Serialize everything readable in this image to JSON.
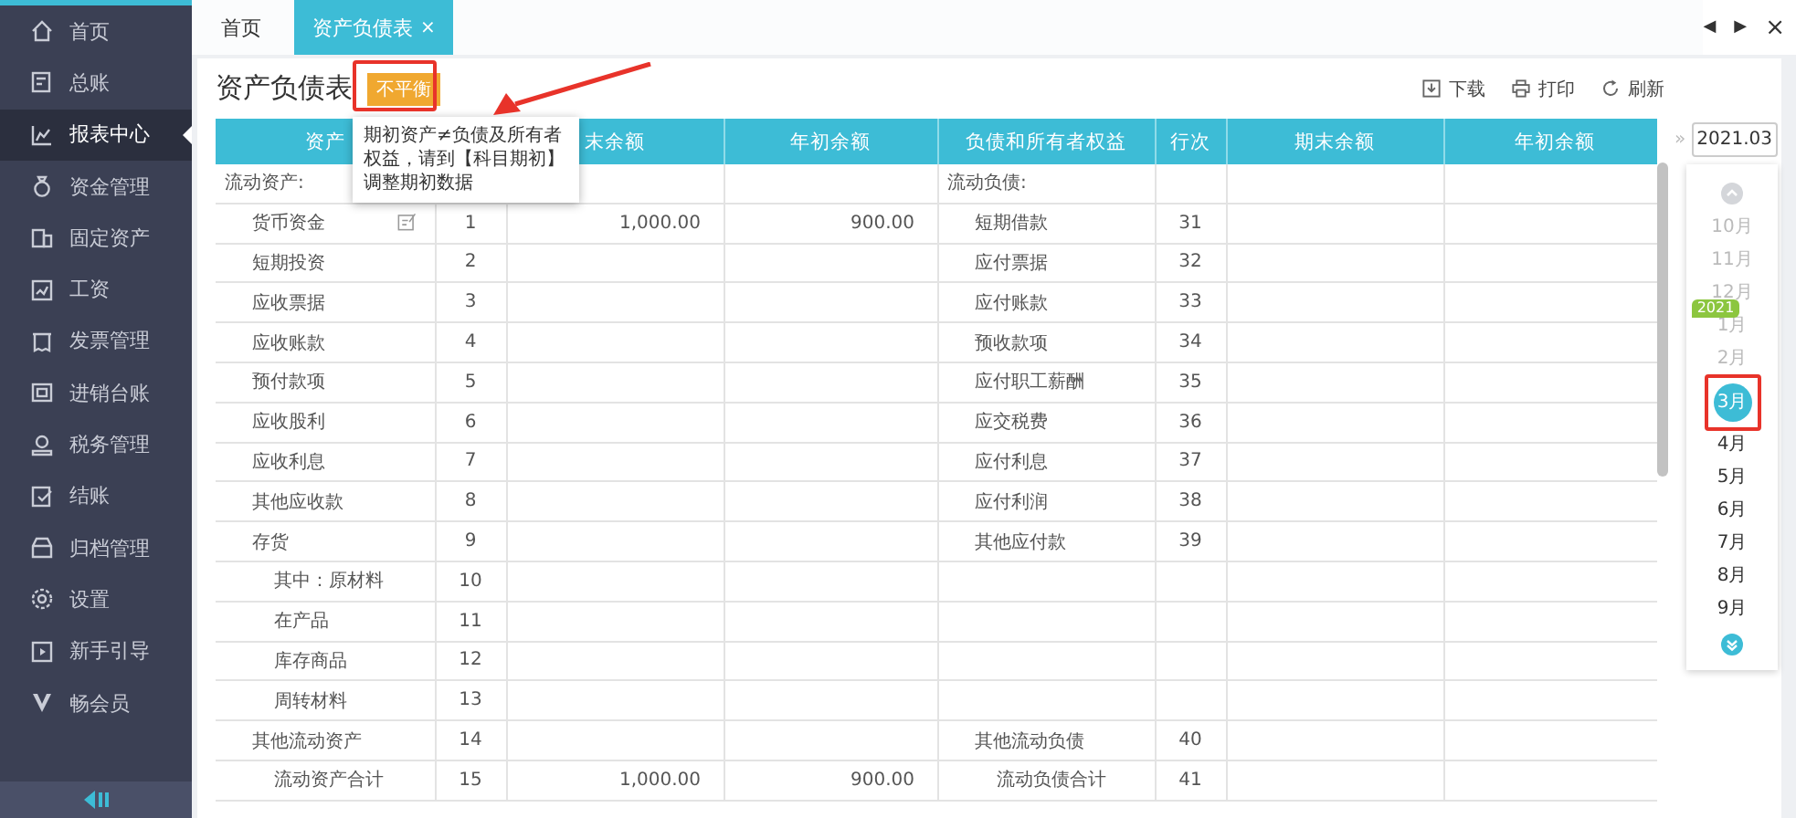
{
  "sidebar": {
    "items": [
      {
        "label": "首页",
        "selected": false
      },
      {
        "label": "总账",
        "selected": false
      },
      {
        "label": "报表中心",
        "selected": true
      },
      {
        "label": "资金管理",
        "selected": false
      },
      {
        "label": "固定资产",
        "selected": false
      },
      {
        "label": "工资",
        "selected": false
      },
      {
        "label": "发票管理",
        "selected": false
      },
      {
        "label": "进销台账",
        "selected": false
      },
      {
        "label": "税务管理",
        "selected": false
      },
      {
        "label": "结账",
        "selected": false
      },
      {
        "label": "归档管理",
        "selected": false
      },
      {
        "label": "设置",
        "selected": false
      },
      {
        "label": "新手引导",
        "selected": false
      },
      {
        "label": "畅会员",
        "selected": false
      }
    ]
  },
  "tabs": [
    {
      "label": "首页",
      "selected": false
    },
    {
      "label": "资产负债表",
      "selected": true,
      "close": "×"
    }
  ],
  "nav_buttons": [
    "◀",
    "▶",
    "×"
  ],
  "report": {
    "title": "资产负债表",
    "status_badge": "不平衡",
    "tooltip": "期初资产≠负债及所有者权益，请到【科目期初】调整期初数据",
    "toolbar": [
      {
        "label": "下载",
        "kind": "download"
      },
      {
        "label": "打印",
        "kind": "print"
      },
      {
        "label": "刷新",
        "kind": "refresh"
      }
    ]
  },
  "table": {
    "columns": [
      "资产",
      null,
      "末余额",
      "年初余额",
      "负债和所有者权益",
      "行次",
      "期末余额",
      "年初余额"
    ],
    "rows": [
      {
        "asset": {
          "name": "流动资产:",
          "kind": "heading"
        },
        "liability": {
          "name": "流动负债:",
          "kind": "heading"
        }
      },
      {
        "asset": {
          "name": "货币资金",
          "kind": "item",
          "editable": true,
          "line": "1",
          "end": "1,000.00",
          "start": "900.00"
        },
        "liability": {
          "name": "短期借款",
          "kind": "item",
          "line": "31"
        }
      },
      {
        "asset": {
          "name": "短期投资",
          "kind": "item",
          "editable": false,
          "line": "2"
        },
        "liability": {
          "name": "应付票据",
          "kind": "item",
          "line": "32"
        }
      },
      {
        "asset": {
          "name": "应收票据",
          "kind": "item",
          "editable": false,
          "line": "3"
        },
        "liability": {
          "name": "应付账款",
          "kind": "item",
          "line": "33"
        }
      },
      {
        "asset": {
          "name": "应收账款",
          "kind": "item",
          "editable": false,
          "line": "4"
        },
        "liability": {
          "name": "预收款项",
          "kind": "item",
          "line": "34"
        }
      },
      {
        "asset": {
          "name": "预付款项",
          "kind": "item",
          "editable": false,
          "line": "5"
        },
        "liability": {
          "name": "应付职工薪酬",
          "kind": "item",
          "line": "35"
        }
      },
      {
        "asset": {
          "name": "应收股利",
          "kind": "item",
          "editable": false,
          "line": "6"
        },
        "liability": {
          "name": "应交税费",
          "kind": "item",
          "line": "36"
        }
      },
      {
        "asset": {
          "name": "应收利息",
          "kind": "item",
          "editable": false,
          "line": "7"
        },
        "liability": {
          "name": "应付利息",
          "kind": "item",
          "line": "37"
        }
      },
      {
        "asset": {
          "name": "其他应收款",
          "kind": "item",
          "editable": false,
          "line": "8"
        },
        "liability": {
          "name": "应付利润",
          "kind": "item",
          "line": "38"
        }
      },
      {
        "asset": {
          "name": "存货",
          "kind": "item",
          "editable": false,
          "line": "9"
        },
        "liability": {
          "name": "其他应付款",
          "kind": "item",
          "line": "39"
        }
      },
      {
        "asset": {
          "name": "其中：原材料",
          "kind": "sub",
          "editable": false,
          "line": "10"
        }
      },
      {
        "asset": {
          "name": "在产品",
          "kind": "sub",
          "editable": false,
          "line": "11"
        }
      },
      {
        "asset": {
          "name": "库存商品",
          "kind": "sub",
          "editable": false,
          "line": "12"
        }
      },
      {
        "asset": {
          "name": "周转材料",
          "kind": "sub",
          "editable": false,
          "line": "13"
        }
      },
      {
        "asset": {
          "name": "其他流动资产",
          "kind": "item",
          "editable": false,
          "line": "14"
        },
        "liability": {
          "name": "其他流动负债",
          "kind": "item",
          "line": "40"
        }
      },
      {
        "asset": {
          "name": "流动资产合计",
          "kind": "sub",
          "editable": false,
          "line": "15",
          "end": "1,000.00",
          "start": "900.00"
        },
        "liability": {
          "name": "流动负债合计",
          "kind": "sub",
          "line": "41"
        }
      }
    ]
  },
  "period": {
    "collapse": "»",
    "value": "2021.03",
    "months": [
      {
        "label": "10月",
        "disabled": true,
        "selected": false
      },
      {
        "label": "11月",
        "disabled": true,
        "selected": false
      },
      {
        "label": "12月",
        "disabled": true,
        "selected": false
      },
      {
        "label": "1月",
        "disabled": true,
        "selected": false,
        "year": "2021"
      },
      {
        "label": "2月",
        "disabled": true,
        "selected": false
      },
      {
        "label": "3月",
        "disabled": false,
        "selected": true
      },
      {
        "label": "4月",
        "disabled": false,
        "selected": false
      },
      {
        "label": "5月",
        "disabled": false,
        "selected": false
      },
      {
        "label": "6月",
        "disabled": false,
        "selected": false
      },
      {
        "label": "7月",
        "disabled": false,
        "selected": false
      },
      {
        "label": "8月",
        "disabled": false,
        "selected": false
      },
      {
        "label": "9月",
        "disabled": false,
        "selected": false
      }
    ]
  }
}
